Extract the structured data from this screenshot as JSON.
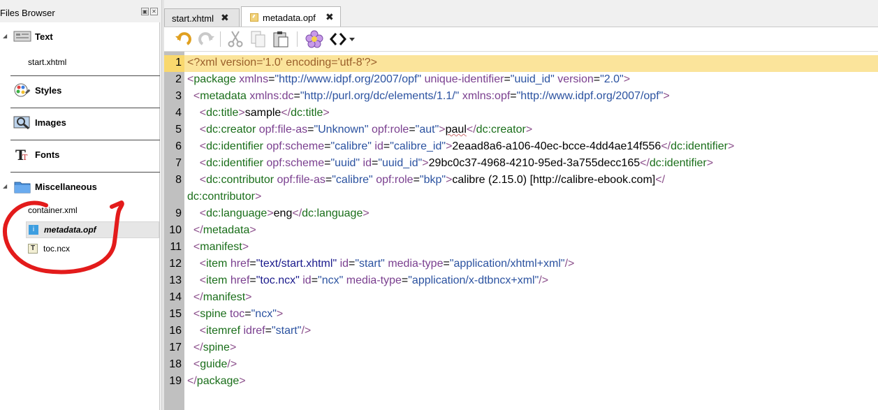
{
  "files_browser": {
    "title": "Files Browser",
    "categories": [
      {
        "label": "Text",
        "files": [
          "start.xhtml"
        ]
      },
      {
        "label": "Styles",
        "files": []
      },
      {
        "label": "Images",
        "files": []
      },
      {
        "label": "Fonts",
        "files": []
      },
      {
        "label": "Miscellaneous",
        "files": [
          "container.xml",
          "metadata.opf",
          "toc.ncx"
        ]
      }
    ],
    "selected_file": "metadata.opf"
  },
  "tabs": [
    {
      "label": "start.xhtml",
      "active": false
    },
    {
      "label": "metadata.opf",
      "active": true
    }
  ],
  "toolbar": {
    "buttons": [
      "undo-icon",
      "redo-icon",
      "cut-icon",
      "copy-icon",
      "paste-icon",
      "flower-icon",
      "code-view-icon"
    ]
  },
  "editor": {
    "current_line": "1",
    "lines": [
      {
        "n": "1",
        "parts": [
          [
            "d",
            "<?xml version='1.0' encoding='utf-8'?>"
          ]
        ]
      },
      {
        "n": "2",
        "parts": [
          [
            "p",
            "<"
          ],
          [
            "t",
            "package"
          ],
          [
            "x",
            " "
          ],
          [
            "a",
            "xmlns"
          ],
          [
            "x",
            "="
          ],
          [
            "v",
            "\"http://www.idpf.org/2007/opf\""
          ],
          [
            "x",
            " "
          ],
          [
            "a",
            "unique-identifier"
          ],
          [
            "x",
            "="
          ],
          [
            "v",
            "\"uuid_id\""
          ],
          [
            "x",
            " "
          ],
          [
            "a",
            "version"
          ],
          [
            "x",
            "="
          ],
          [
            "v",
            "\"2.0\""
          ],
          [
            "p",
            ">"
          ]
        ]
      },
      {
        "n": "3",
        "parts": [
          [
            "x",
            "  "
          ],
          [
            "p",
            "<"
          ],
          [
            "t",
            "metadata"
          ],
          [
            "x",
            " "
          ],
          [
            "a",
            "xmlns:dc"
          ],
          [
            "x",
            "="
          ],
          [
            "v",
            "\"http://purl.org/dc/elements/1.1/\""
          ],
          [
            "x",
            " "
          ],
          [
            "a",
            "xmlns:opf"
          ],
          [
            "x",
            "="
          ],
          [
            "v",
            "\"http://www.idpf.org/2007/opf\""
          ],
          [
            "p",
            ">"
          ]
        ]
      },
      {
        "n": "4",
        "parts": [
          [
            "x",
            "    "
          ],
          [
            "p",
            "<"
          ],
          [
            "t",
            "dc:title"
          ],
          [
            "p",
            ">"
          ],
          [
            "x",
            "sample"
          ],
          [
            "p",
            "</"
          ],
          [
            "t",
            "dc:title"
          ],
          [
            "p",
            ">"
          ]
        ]
      },
      {
        "n": "5",
        "parts": [
          [
            "x",
            "    "
          ],
          [
            "p",
            "<"
          ],
          [
            "t",
            "dc:creator"
          ],
          [
            "x",
            " "
          ],
          [
            "a",
            "opf:file-as"
          ],
          [
            "x",
            "="
          ],
          [
            "v",
            "\"Unknown\""
          ],
          [
            "x",
            " "
          ],
          [
            "a",
            "opf:role"
          ],
          [
            "x",
            "="
          ],
          [
            "v",
            "\"aut\""
          ],
          [
            "p",
            ">"
          ],
          [
            "sq",
            "paul"
          ],
          [
            "p",
            "</"
          ],
          [
            "t",
            "dc:creator"
          ],
          [
            "p",
            ">"
          ]
        ]
      },
      {
        "n": "6",
        "parts": [
          [
            "x",
            "    "
          ],
          [
            "p",
            "<"
          ],
          [
            "t",
            "dc:identifier"
          ],
          [
            "x",
            " "
          ],
          [
            "a",
            "opf:scheme"
          ],
          [
            "x",
            "="
          ],
          [
            "v",
            "\"calibre\""
          ],
          [
            "x",
            " "
          ],
          [
            "a",
            "id"
          ],
          [
            "x",
            "="
          ],
          [
            "v",
            "\"calibre_id\""
          ],
          [
            "p",
            ">"
          ],
          [
            "x",
            "2eaad8a6-a106-40ec-bcce-4dd4ae14f556"
          ],
          [
            "p",
            "</"
          ],
          [
            "t",
            "dc:identifier"
          ],
          [
            "p",
            ">"
          ]
        ]
      },
      {
        "n": "7",
        "parts": [
          [
            "x",
            "    "
          ],
          [
            "p",
            "<"
          ],
          [
            "t",
            "dc:identifier"
          ],
          [
            "x",
            " "
          ],
          [
            "a",
            "opf:scheme"
          ],
          [
            "x",
            "="
          ],
          [
            "v",
            "\"uuid\""
          ],
          [
            "x",
            " "
          ],
          [
            "a",
            "id"
          ],
          [
            "x",
            "="
          ],
          [
            "v",
            "\"uuid_id\""
          ],
          [
            "p",
            ">"
          ],
          [
            "x",
            "29bc0c37-4968-4210-95ed-3a755decc165"
          ],
          [
            "p",
            "</"
          ],
          [
            "t",
            "dc:identifier"
          ],
          [
            "p",
            ">"
          ]
        ]
      },
      {
        "n": "8",
        "parts": [
          [
            "x",
            "    "
          ],
          [
            "p",
            "<"
          ],
          [
            "t",
            "dc:contributor"
          ],
          [
            "x",
            " "
          ],
          [
            "a",
            "opf:file-as"
          ],
          [
            "x",
            "="
          ],
          [
            "v",
            "\"calibre\""
          ],
          [
            "x",
            " "
          ],
          [
            "a",
            "opf:role"
          ],
          [
            "x",
            "="
          ],
          [
            "v",
            "\"bkp\""
          ],
          [
            "p",
            ">"
          ],
          [
            "x",
            "calibre (2.15.0) [http://calibre-ebook.com]"
          ],
          [
            "p",
            "</"
          ]
        ]
      },
      {
        "n": "",
        "parts": [
          [
            "t",
            "dc:contributor"
          ],
          [
            "p",
            ">"
          ]
        ]
      },
      {
        "n": "9",
        "parts": [
          [
            "x",
            "    "
          ],
          [
            "p",
            "<"
          ],
          [
            "t",
            "dc:language"
          ],
          [
            "p",
            ">"
          ],
          [
            "x",
            "eng"
          ],
          [
            "p",
            "</"
          ],
          [
            "t",
            "dc:language"
          ],
          [
            "p",
            ">"
          ]
        ]
      },
      {
        "n": "10",
        "parts": [
          [
            "x",
            "  "
          ],
          [
            "p",
            "</"
          ],
          [
            "t",
            "metadata"
          ],
          [
            "p",
            ">"
          ]
        ]
      },
      {
        "n": "11",
        "parts": [
          [
            "x",
            "  "
          ],
          [
            "p",
            "<"
          ],
          [
            "t",
            "manifest"
          ],
          [
            "p",
            ">"
          ]
        ]
      },
      {
        "n": "12",
        "parts": [
          [
            "x",
            "    "
          ],
          [
            "p",
            "<"
          ],
          [
            "t",
            "item"
          ],
          [
            "x",
            " "
          ],
          [
            "a",
            "href"
          ],
          [
            "x",
            "="
          ],
          [
            "vl",
            "\"text/start.xhtml\""
          ],
          [
            "x",
            " "
          ],
          [
            "a",
            "id"
          ],
          [
            "x",
            "="
          ],
          [
            "v",
            "\"start\""
          ],
          [
            "x",
            " "
          ],
          [
            "a",
            "media-type"
          ],
          [
            "x",
            "="
          ],
          [
            "v",
            "\"application/xhtml+xml\""
          ],
          [
            "p",
            "/>"
          ]
        ]
      },
      {
        "n": "13",
        "parts": [
          [
            "x",
            "    "
          ],
          [
            "p",
            "<"
          ],
          [
            "t",
            "item"
          ],
          [
            "x",
            " "
          ],
          [
            "a",
            "href"
          ],
          [
            "x",
            "="
          ],
          [
            "vl",
            "\"toc.ncx\""
          ],
          [
            "x",
            " "
          ],
          [
            "a",
            "id"
          ],
          [
            "x",
            "="
          ],
          [
            "v",
            "\"ncx\""
          ],
          [
            "x",
            " "
          ],
          [
            "a",
            "media-type"
          ],
          [
            "x",
            "="
          ],
          [
            "v",
            "\"application/x-dtbncx+xml\""
          ],
          [
            "p",
            "/>"
          ]
        ]
      },
      {
        "n": "14",
        "parts": [
          [
            "x",
            "  "
          ],
          [
            "p",
            "</"
          ],
          [
            "t",
            "manifest"
          ],
          [
            "p",
            ">"
          ]
        ]
      },
      {
        "n": "15",
        "parts": [
          [
            "x",
            "  "
          ],
          [
            "p",
            "<"
          ],
          [
            "t",
            "spine"
          ],
          [
            "x",
            " "
          ],
          [
            "a",
            "toc"
          ],
          [
            "x",
            "="
          ],
          [
            "v",
            "\"ncx\""
          ],
          [
            "p",
            ">"
          ]
        ]
      },
      {
        "n": "16",
        "parts": [
          [
            "x",
            "    "
          ],
          [
            "p",
            "<"
          ],
          [
            "t",
            "itemref"
          ],
          [
            "x",
            " "
          ],
          [
            "a",
            "idref"
          ],
          [
            "x",
            "="
          ],
          [
            "v",
            "\"start\""
          ],
          [
            "p",
            "/>"
          ]
        ]
      },
      {
        "n": "17",
        "parts": [
          [
            "x",
            "  "
          ],
          [
            "p",
            "</"
          ],
          [
            "t",
            "spine"
          ],
          [
            "p",
            ">"
          ]
        ]
      },
      {
        "n": "18",
        "parts": [
          [
            "x",
            "  "
          ],
          [
            "p",
            "<"
          ],
          [
            "t",
            "guide"
          ],
          [
            "p",
            "/>"
          ]
        ]
      },
      {
        "n": "19",
        "parts": [
          [
            "p",
            "</"
          ],
          [
            "t",
            "package"
          ],
          [
            "p",
            ">"
          ]
        ]
      }
    ]
  },
  "colors": {
    "current_line_bg": "#fbe49b",
    "gutter_bg": "#c0c0c0",
    "annotation_circle": "#e31b1b"
  }
}
